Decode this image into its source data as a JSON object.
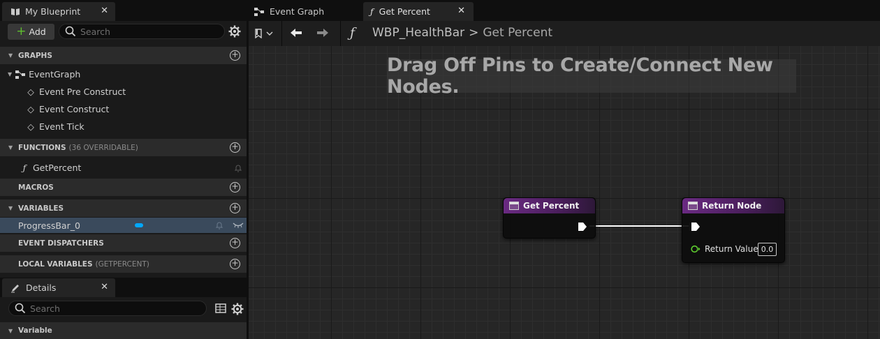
{
  "my_blueprint": {
    "tab_label": "My Blueprint",
    "close_glyph": "✕",
    "add_label": "Add",
    "search_placeholder": "Search",
    "sections": {
      "graphs": "GRAPHS",
      "functions": "FUNCTIONS",
      "functions_sub": "(36 OVERRIDABLE)",
      "macros": "MACROS",
      "variables": "VARIABLES",
      "event_dispatchers": "EVENT DISPATCHERS",
      "local_variables": "LOCAL VARIABLES",
      "local_variables_sub": "(GETPERCENT)"
    },
    "graph_items": {
      "event_graph": "EventGraph",
      "events": [
        "Event Pre Construct",
        "Event Construct",
        "Event Tick"
      ]
    },
    "function_item": "GetPercent",
    "variable_item": "ProgressBar_0",
    "variable_color": "#00a8ff"
  },
  "details": {
    "tab_label": "Details",
    "search_placeholder": "Search",
    "section": "Variable"
  },
  "graph": {
    "tabs": [
      {
        "label": "Event Graph"
      },
      {
        "label": "Get Percent"
      }
    ],
    "breadcrumb": {
      "blueprint": "WBP_HealthBar",
      "separator": ">",
      "function": "Get Percent"
    },
    "hint": "Drag Off Pins to Create/Connect New Nodes.",
    "nodes": {
      "entry": {
        "title": "Get Percent"
      },
      "return": {
        "title": "Return Node",
        "pin_label": "Return Value",
        "pin_value": "0.0"
      }
    },
    "colors": {
      "node_header": "#6a2a82",
      "float_pin": "#5fcf2f",
      "exec_wire": "#ffffff"
    }
  }
}
